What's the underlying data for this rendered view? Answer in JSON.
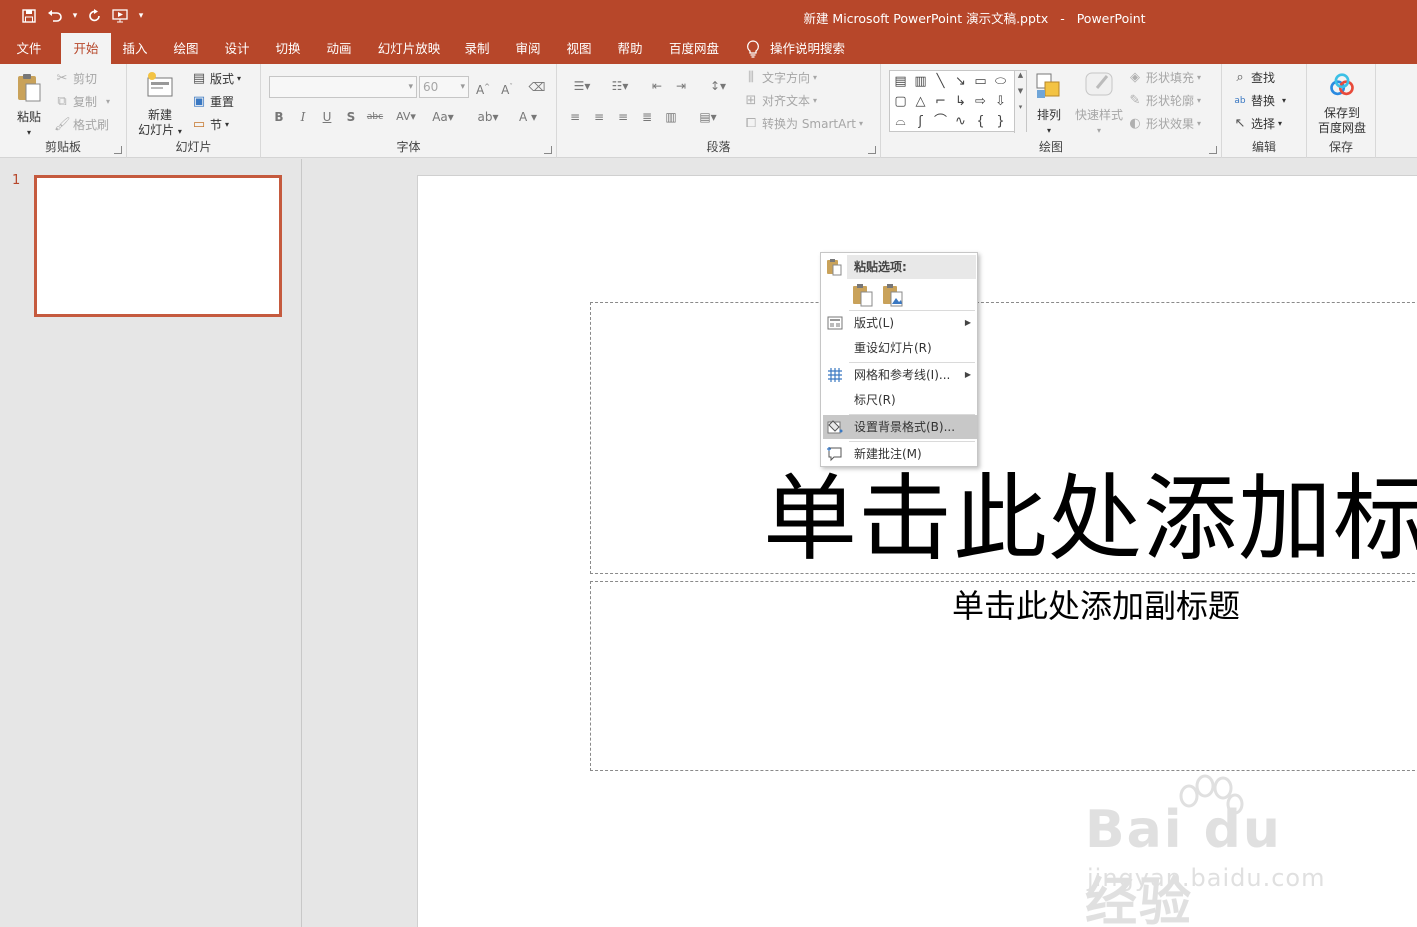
{
  "window": {
    "title": "新建 Microsoft PowerPoint 演示文稿.pptx",
    "app": "PowerPoint"
  },
  "tabs": [
    "文件",
    "开始",
    "插入",
    "绘图",
    "设计",
    "切换",
    "动画",
    "幻灯片放映",
    "录制",
    "审阅",
    "视图",
    "帮助",
    "百度网盘"
  ],
  "active_tab": "开始",
  "tellme": "操作说明搜索",
  "ribbon": {
    "clipboard": {
      "label": "剪贴板",
      "paste": "粘贴",
      "cut": "剪切",
      "copy": "复制",
      "format_painter": "格式刷"
    },
    "slides": {
      "label": "幻灯片",
      "new_slide_1": "新建",
      "new_slide_2": "幻灯片",
      "layout": "版式",
      "reset": "重置",
      "section": "节"
    },
    "font": {
      "label": "字体",
      "font_name": "",
      "font_size": "60"
    },
    "paragraph": {
      "label": "段落",
      "text_direction": "文字方向",
      "align_text": "对齐文本",
      "smartart": "转换为 SmartArt"
    },
    "drawing": {
      "label": "绘图",
      "arrange": "排列",
      "quick_styles": "快速样式",
      "shape_fill": "形状填充",
      "shape_outline": "形状轮廓",
      "shape_effects": "形状效果"
    },
    "editing": {
      "label": "编辑",
      "find": "查找",
      "replace": "替换",
      "select": "选择"
    },
    "save": {
      "label": "保存",
      "save_to_1": "保存到",
      "save_to_2": "百度网盘"
    }
  },
  "thumbnail": {
    "number": "1"
  },
  "slide": {
    "title_placeholder": "单击此处添加标题",
    "subtitle_placeholder": "单击此处添加副标题"
  },
  "context_menu": {
    "paste_header": "粘贴选项:",
    "items": [
      {
        "label": "版式(L)",
        "submenu": true
      },
      {
        "label": "重设幻灯片(R)",
        "submenu": false
      },
      {
        "label": "网格和参考线(I)...",
        "submenu": true
      },
      {
        "label": "标尺(R)",
        "submenu": false
      },
      {
        "label": "设置背景格式(B)...",
        "submenu": false,
        "highlighted": true
      },
      {
        "label": "新建批注(M)",
        "submenu": false
      }
    ]
  },
  "watermark": {
    "logo": "Bai du 经验",
    "url": "jingyan.baidu.com"
  },
  "colors": {
    "accent": "#b7472a",
    "ribbon_bg": "#f3f3f3",
    "canvas_bg": "#e6e6e6"
  }
}
